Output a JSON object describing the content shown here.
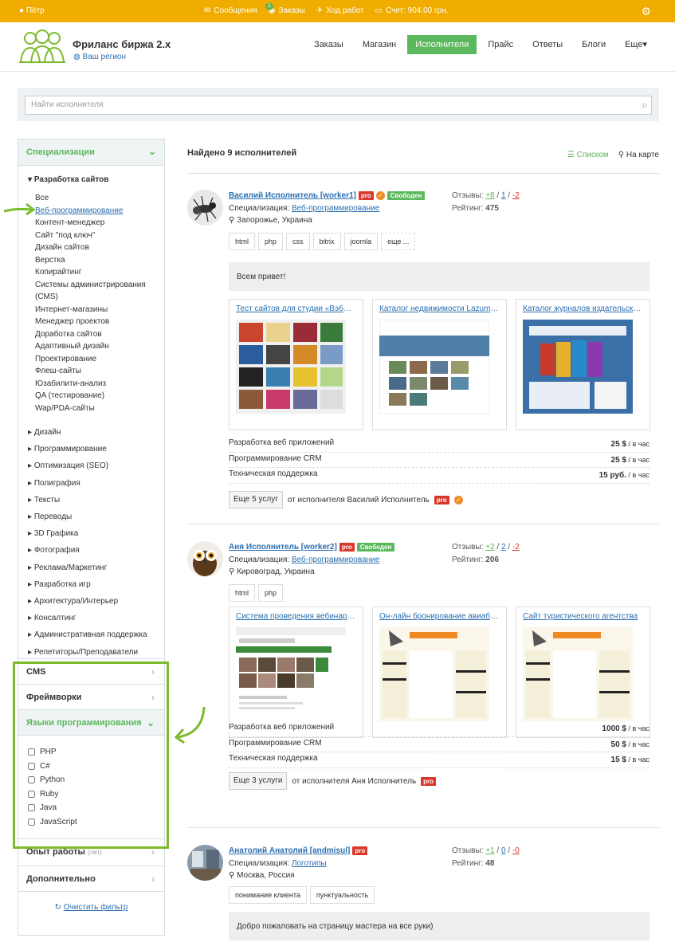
{
  "topbar": {
    "user": "Пётр",
    "messages": "Сообщения",
    "orders_badge": "1",
    "orders": "Заказы",
    "progress": "Ход работ",
    "account": "Счет: 904.00 грн."
  },
  "header": {
    "brand": "Фриланс биржа 2.х",
    "region": "Ваш регион"
  },
  "nav": [
    {
      "label": "Заказы"
    },
    {
      "label": "Магазин"
    },
    {
      "label": "Исполнители",
      "active": true
    },
    {
      "label": "Прайс"
    },
    {
      "label": "Ответы"
    },
    {
      "label": "Блоги"
    },
    {
      "label": "Еще▾"
    }
  ],
  "search": {
    "placeholder": "Найти исполнителя"
  },
  "sidebar": {
    "spec_title": "Специализации",
    "category": "Разработка сайтов",
    "subs": [
      "Все",
      "Веб-программирование",
      "Контент-менеджер",
      "Сайт \"под ключ\"",
      "Дизайн сайтов",
      "Верстка",
      "Копирайтинг",
      "Системы администрирования",
      "(CMS)",
      "Интернет-магазины",
      "Менеджер проектов",
      "Доработка сайтов",
      "Адаптивный дизайн",
      "Проектирование",
      "Флеш-сайты",
      "Юзабилити-анализ",
      "QA (тестирование)",
      "Wap/PDA-сайты"
    ],
    "categories": [
      "Дизайн",
      "Программирование",
      "Оптимизация (SEO)",
      "Полиграфия",
      "Тексты",
      "Переводы",
      "3D Графика",
      "Фотография",
      "Реклама/Маркетинг",
      "Разработка игр",
      "Архитектура/Интерьер",
      "Консалтинг",
      "Административная поддержка",
      "Репетиторы/Преподаватели"
    ],
    "cms": "CMS",
    "frameworks": "Фреймворки",
    "languages": "Языки программирования",
    "langs": [
      "PHP",
      "C#",
      "Python",
      "Ruby",
      "Java",
      "JavaScript"
    ],
    "experience": "Опыт работы",
    "experience_note": "(лет)",
    "additional": "Дополнительно",
    "clear": "Очистить фильтр"
  },
  "main": {
    "found": "Найдено 9 исполнителей",
    "view_list": "Списком",
    "view_map": "На карте"
  },
  "freelancers": [
    {
      "name": "Василий Исполнитель [worker1]",
      "pro": "pro",
      "status": "Свободен",
      "spec_label": "Специализация:",
      "spec": "Веб-программирование",
      "location": "Запорожье, Украина",
      "reviews_label": "Отзывы:",
      "rev_pos": "+8",
      "rev_zero": "1",
      "rev_neg": "-2",
      "rating_label": "Рейтинг:",
      "rating": "475",
      "tags": [
        "html",
        "php",
        "css",
        "bitrix",
        "joomla",
        "еще ..."
      ],
      "message": "Всем привет!",
      "works": [
        "Тест сайтов для студии «ВэбПре...",
        "Каталог недвижимости Lazumibe...",
        "Каталог журналов издательского..."
      ],
      "prices": [
        {
          "service": "Разработка веб приложений",
          "amount": "25 $",
          "unit": "/ в час"
        },
        {
          "service": "Программирование CRM",
          "amount": "25 $",
          "unit": "/ в час"
        },
        {
          "service": "Техническая поддержка",
          "amount": "15 руб.",
          "unit": "/ в час"
        }
      ],
      "more": "Еще 5 услуг",
      "more_text": "от исполнителя Василий Исполнитель"
    },
    {
      "name": "Аня Исполнитель [worker2]",
      "pro": "pro",
      "status": "Свободен",
      "spec_label": "Специализация:",
      "spec": "Веб-программирование",
      "location": "Кировоград, Украина",
      "reviews_label": "Отзывы:",
      "rev_pos": "+2",
      "rev_zero": "2",
      "rev_neg": "-2",
      "rating_label": "Рейтинг:",
      "rating": "206",
      "tags": [
        "html",
        "php"
      ],
      "works": [
        "Система проведения вебинаров д...",
        "Он-лайн бронирование авиабилет...",
        "Сайт туристического агентства"
      ],
      "prices": [
        {
          "service": "Разработка веб приложений",
          "amount": "1000 $",
          "unit": "/ в час"
        },
        {
          "service": "Программирование CRM",
          "amount": "50 $",
          "unit": "/ в час"
        },
        {
          "service": "Техническая поддержка",
          "amount": "15 $",
          "unit": "/ в час"
        }
      ],
      "more": "Еще 3 услуги",
      "more_text": "от исполнителя Аня Исполнитель"
    },
    {
      "name": "Анатолий Анатолий [andmisul]",
      "pro": "pro",
      "spec_label": "Специализация:",
      "spec": "Логотипы",
      "location": "Москва, Россия",
      "reviews_label": "Отзывы:",
      "rev_pos": "+1",
      "rev_zero": "0",
      "rev_neg": "-0",
      "rating_label": "Рейтинг:",
      "rating": "48",
      "tags": [
        "понимание клиента",
        "пунктуальность"
      ],
      "message": "Добро пожаловать на страницу мастера на все руки)"
    }
  ],
  "colors": {
    "topbar": "#f0ad00",
    "accent": "#5cb85c",
    "link": "#2a6fb0",
    "pro": "#d9372b",
    "highlight": "#7dbb2c"
  }
}
